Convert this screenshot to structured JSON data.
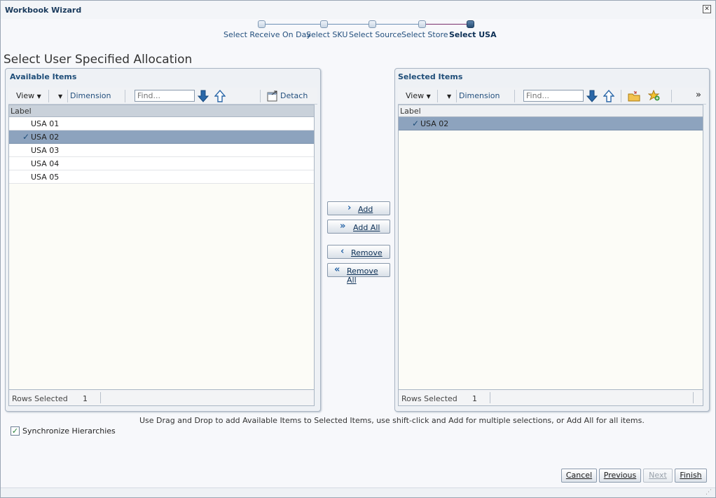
{
  "window": {
    "title": "Workbook Wizard"
  },
  "train": {
    "steps": [
      {
        "label": "Select Receive On Day"
      },
      {
        "label": "Select SKU"
      },
      {
        "label": "Select Source"
      },
      {
        "label": "Select Store"
      },
      {
        "label": "Select USA"
      }
    ],
    "current_index": 4
  },
  "page": {
    "heading": "Select User Specified Allocation"
  },
  "available": {
    "title": "Available Items",
    "view_label": "View",
    "dimension_label": "Dimension",
    "find_placeholder": "Find...",
    "detach_label": "Detach",
    "column_header": "Label",
    "rows": [
      {
        "label": "USA 01",
        "selected": false
      },
      {
        "label": "USA 02",
        "selected": true
      },
      {
        "label": "USA 03",
        "selected": false
      },
      {
        "label": "USA 04",
        "selected": false
      },
      {
        "label": "USA 05",
        "selected": false
      }
    ],
    "rows_selected_label": "Rows Selected",
    "rows_selected_count": "1"
  },
  "selected": {
    "title": "Selected Items",
    "view_label": "View",
    "dimension_label": "Dimension",
    "find_placeholder": "Find...",
    "more_label": "»",
    "column_header": "Label",
    "rows": [
      {
        "label": "USA 02",
        "selected": true
      }
    ],
    "rows_selected_label": "Rows Selected",
    "rows_selected_count": "1"
  },
  "shuttle": {
    "add_label": "Add",
    "add_all_label": "Add All",
    "remove_label": "Remove",
    "remove_all_label": "Remove All"
  },
  "hint": "Use Drag and Drop to add Available Items to Selected Items, use shift-click and Add for multiple selections, or Add All for all items.",
  "sync": {
    "label": "Synchronize Hierarchies",
    "checked": true
  },
  "buttons": {
    "cancel": "Cancel",
    "previous": "Previous",
    "next": "Next",
    "finish": "Finish"
  },
  "colors": {
    "accent": "#1f4e79",
    "selected_row": "#8da3be",
    "arrow_blue": "#2a67a8"
  }
}
